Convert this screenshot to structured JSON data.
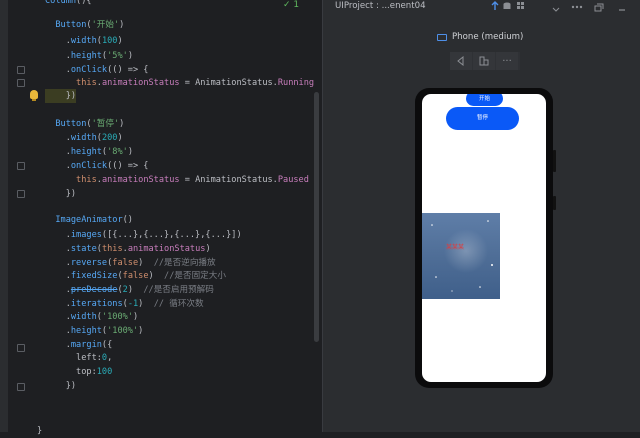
{
  "editor": {
    "lines": [
      {
        "id": "l1",
        "html": "<span class=\"fn\">Column</span>(){"
      },
      {
        "id": "l2",
        "html": "  <span class=\"fn\">Button</span>(<span class=\"str\">'开始'</span>)"
      },
      {
        "id": "l3",
        "html": "    .<span class=\"fn\">width</span>(<span class=\"num\">100</span>)"
      },
      {
        "id": "l4",
        "html": "    .<span class=\"fn\">height</span>(<span class=\"str\">'5%'</span>)"
      },
      {
        "id": "l5",
        "html": "    .<span class=\"fn\">onClick</span>(() => {"
      },
      {
        "id": "l6",
        "html": "      <span class=\"kw\">this</span>.<span class=\"prop\">animationStatus</span> = AnimationStatus.<span class=\"prop\">Running</span>"
      },
      {
        "id": "l7",
        "html": "    })"
      },
      {
        "id": "l8",
        "html": ""
      },
      {
        "id": "l9",
        "html": "  <span class=\"fn\">Button</span>(<span class=\"str\">'暂停'</span>)"
      },
      {
        "id": "l10",
        "html": "    .<span class=\"fn\">width</span>(<span class=\"num\">200</span>)"
      },
      {
        "id": "l11",
        "html": "    .<span class=\"fn\">height</span>(<span class=\"str\">'8%'</span>)"
      },
      {
        "id": "l12",
        "html": "    .<span class=\"fn\">onClick</span>(() => {"
      },
      {
        "id": "l13",
        "html": "      <span class=\"kw\">this</span>.<span class=\"prop\">animationStatus</span> = AnimationStatus.<span class=\"prop\">Paused</span>"
      },
      {
        "id": "l14",
        "html": "    })"
      },
      {
        "id": "l15",
        "html": ""
      },
      {
        "id": "l16",
        "html": "  <span class=\"fn\">ImageAnimator</span>()"
      },
      {
        "id": "l17",
        "html": "    .<span class=\"fn\">images</span>([{...},{...},{...},{...}])"
      },
      {
        "id": "l18",
        "html": "    .<span class=\"fn\">state</span>(<span class=\"kw\">this</span>.<span class=\"prop\">animationStatus</span>)"
      },
      {
        "id": "l19",
        "html": "    .<span class=\"fn\">reverse</span>(<span class=\"kw\">false</span>)  <span class=\"cmt\">//是否逆向播放</span>"
      },
      {
        "id": "l20",
        "html": "    .<span class=\"fn\">fixedSize</span>(<span class=\"kw\">false</span>)  <span class=\"cmt\">//是否固定大小</span>"
      },
      {
        "id": "l21",
        "html": "    .<span class=\"fn strike\">preDecode</span>(<span class=\"num\">2</span>)  <span class=\"cmt\">//是否启用预解码</span>"
      },
      {
        "id": "l22",
        "html": "    .<span class=\"fn\">iterations</span>(<span class=\"num\">-1</span>)  <span class=\"cmt\">// 循环次数</span>"
      },
      {
        "id": "l23",
        "html": "    .<span class=\"fn\">width</span>(<span class=\"str\">'100%'</span>)"
      },
      {
        "id": "l24",
        "html": "    .<span class=\"fn\">height</span>(<span class=\"str\">'100%'</span>)"
      },
      {
        "id": "l25",
        "html": "    .<span class=\"fn\">margin</span>({"
      },
      {
        "id": "l26",
        "html": "      left:<span class=\"num\">0</span>,"
      },
      {
        "id": "l27",
        "html": "      top:<span class=\"num\">100</span>"
      },
      {
        "id": "l28",
        "html": "    })"
      },
      {
        "id": "l29",
        "html": ""
      },
      {
        "id": "l30",
        "html": ""
      },
      {
        "id": "l31",
        "html": "}"
      }
    ],
    "check_mark": "✓ 1"
  },
  "preview": {
    "title": "UIProject : ...enent04",
    "device_label": "Phone (medium)",
    "more_glyph": "···",
    "buttons": {
      "start": "开始",
      "pause": "暂停"
    },
    "overlay_text": "某某某"
  }
}
